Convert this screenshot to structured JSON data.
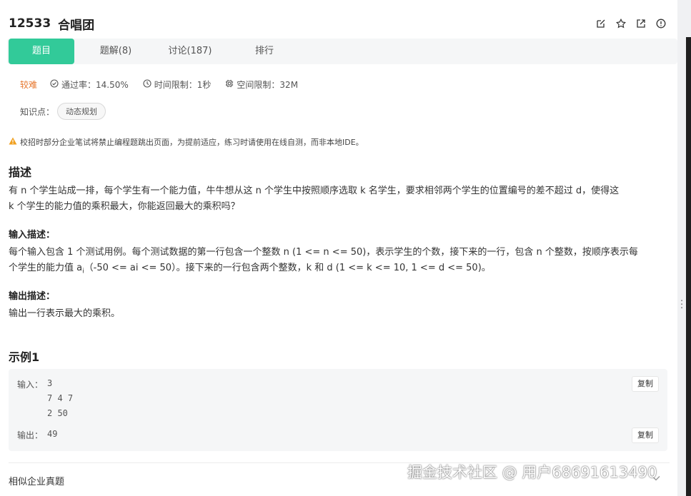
{
  "problem": {
    "id": "12533",
    "title": "合唱团"
  },
  "title_icons": [
    "edit-icon",
    "star-icon",
    "external-link-icon",
    "info-icon"
  ],
  "tabs": [
    {
      "label": "题目"
    },
    {
      "label": "题解(8)"
    },
    {
      "label": "讨论(187)"
    },
    {
      "label": "排行"
    }
  ],
  "meta": {
    "difficulty": "较难",
    "pass_rate": "通过率：14.50%",
    "time_limit": "时间限制：1秒",
    "space_limit": "空间限制：32M"
  },
  "knowledge": {
    "label": "知识点：",
    "tag": "动态规划"
  },
  "notice": "校招时部分企业笔试将禁止编程题跳出页面，为提前适应，练习时请使用在线自测，而非本地IDE。",
  "description": {
    "title": "描述",
    "line1": "有 n 个学生站成一排，每个学生有一个能力值，牛牛想从这 n 个学生中按照顺序选取 k 名学生，要求相邻两个学生的位置编号的差不超过 d，使得这",
    "line2": "k 个学生的能力值的乘积最大，你能返回最大的乘积吗？"
  },
  "input_desc": {
    "title": "输入描述：",
    "line1": "每个输入包含 1 个测试用例。每个测试数据的第一行包含一个整数 n (1 <= n <= 50)，表示学生的个数，接下来的一行，包含 n 个整数，按顺序表示每",
    "line2_pre": "个学生的能力值 a",
    "line2_sub": "i",
    "line2_post": "（-50 <= ai <= 50）。接下来的一行包含两个整数，k 和 d (1 <= k <= 10, 1 <= d <= 50)。"
  },
  "output_desc": {
    "title": "输出描述：",
    "text": "输出一行表示最大的乘积。"
  },
  "example": {
    "title": "示例1",
    "input_label": "输入：",
    "input_lines": [
      "3",
      "7 4 7",
      "2 50"
    ],
    "output_label": "输出：",
    "output": "49",
    "copy_label": "复制"
  },
  "similar": {
    "label": "相似企业真题"
  },
  "watermark": "掘金技术社区 @ 用户68691613490",
  "colors": {
    "accent": "#32ca99",
    "difficulty": "#e6772e",
    "warning": "#f0a020"
  }
}
